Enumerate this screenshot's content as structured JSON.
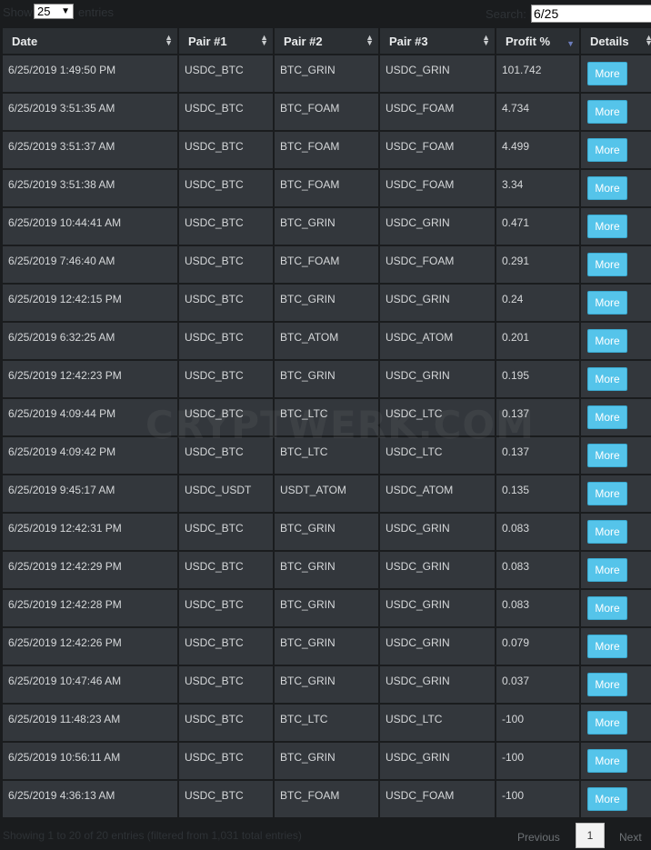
{
  "controls": {
    "show_prefix": "Show",
    "length_value": "25",
    "show_suffix": "entries",
    "search_label": "Search:",
    "search_value": "6/25"
  },
  "table": {
    "columns": [
      "Date",
      "Pair #1",
      "Pair #2",
      "Pair #3",
      "Profit %",
      "Details"
    ],
    "rows": [
      {
        "date": "6/25/2019 1:49:50 PM",
        "pair1": "USDC_BTC",
        "pair2": "BTC_GRIN",
        "pair3": "USDC_GRIN",
        "profit": "101.742",
        "details": "More"
      },
      {
        "date": "6/25/2019 3:51:35 AM",
        "pair1": "USDC_BTC",
        "pair2": "BTC_FOAM",
        "pair3": "USDC_FOAM",
        "profit": "4.734",
        "details": "More"
      },
      {
        "date": "6/25/2019 3:51:37 AM",
        "pair1": "USDC_BTC",
        "pair2": "BTC_FOAM",
        "pair3": "USDC_FOAM",
        "profit": "4.499",
        "details": "More"
      },
      {
        "date": "6/25/2019 3:51:38 AM",
        "pair1": "USDC_BTC",
        "pair2": "BTC_FOAM",
        "pair3": "USDC_FOAM",
        "profit": "3.34",
        "details": "More"
      },
      {
        "date": "6/25/2019 10:44:41 AM",
        "pair1": "USDC_BTC",
        "pair2": "BTC_GRIN",
        "pair3": "USDC_GRIN",
        "profit": "0.471",
        "details": "More"
      },
      {
        "date": "6/25/2019 7:46:40 AM",
        "pair1": "USDC_BTC",
        "pair2": "BTC_FOAM",
        "pair3": "USDC_FOAM",
        "profit": "0.291",
        "details": "More"
      },
      {
        "date": "6/25/2019 12:42:15 PM",
        "pair1": "USDC_BTC",
        "pair2": "BTC_GRIN",
        "pair3": "USDC_GRIN",
        "profit": "0.24",
        "details": "More"
      },
      {
        "date": "6/25/2019 6:32:25 AM",
        "pair1": "USDC_BTC",
        "pair2": "BTC_ATOM",
        "pair3": "USDC_ATOM",
        "profit": "0.201",
        "details": "More"
      },
      {
        "date": "6/25/2019 12:42:23 PM",
        "pair1": "USDC_BTC",
        "pair2": "BTC_GRIN",
        "pair3": "USDC_GRIN",
        "profit": "0.195",
        "details": "More"
      },
      {
        "date": "6/25/2019 4:09:44 PM",
        "pair1": "USDC_BTC",
        "pair2": "BTC_LTC",
        "pair3": "USDC_LTC",
        "profit": "0.137",
        "details": "More"
      },
      {
        "date": "6/25/2019 4:09:42 PM",
        "pair1": "USDC_BTC",
        "pair2": "BTC_LTC",
        "pair3": "USDC_LTC",
        "profit": "0.137",
        "details": "More"
      },
      {
        "date": "6/25/2019 9:45:17 AM",
        "pair1": "USDC_USDT",
        "pair2": "USDT_ATOM",
        "pair3": "USDC_ATOM",
        "profit": "0.135",
        "details": "More"
      },
      {
        "date": "6/25/2019 12:42:31 PM",
        "pair1": "USDC_BTC",
        "pair2": "BTC_GRIN",
        "pair3": "USDC_GRIN",
        "profit": "0.083",
        "details": "More"
      },
      {
        "date": "6/25/2019 12:42:29 PM",
        "pair1": "USDC_BTC",
        "pair2": "BTC_GRIN",
        "pair3": "USDC_GRIN",
        "profit": "0.083",
        "details": "More"
      },
      {
        "date": "6/25/2019 12:42:28 PM",
        "pair1": "USDC_BTC",
        "pair2": "BTC_GRIN",
        "pair3": "USDC_GRIN",
        "profit": "0.083",
        "details": "More"
      },
      {
        "date": "6/25/2019 12:42:26 PM",
        "pair1": "USDC_BTC",
        "pair2": "BTC_GRIN",
        "pair3": "USDC_GRIN",
        "profit": "0.079",
        "details": "More"
      },
      {
        "date": "6/25/2019 10:47:46 AM",
        "pair1": "USDC_BTC",
        "pair2": "BTC_GRIN",
        "pair3": "USDC_GRIN",
        "profit": "0.037",
        "details": "More"
      },
      {
        "date": "6/25/2019 11:48:23 AM",
        "pair1": "USDC_BTC",
        "pair2": "BTC_LTC",
        "pair3": "USDC_LTC",
        "profit": "-100",
        "details": "More"
      },
      {
        "date": "6/25/2019 10:56:11 AM",
        "pair1": "USDC_BTC",
        "pair2": "BTC_GRIN",
        "pair3": "USDC_GRIN",
        "profit": "-100",
        "details": "More"
      },
      {
        "date": "6/25/2019 4:36:13 AM",
        "pair1": "USDC_BTC",
        "pair2": "BTC_FOAM",
        "pair3": "USDC_FOAM",
        "profit": "-100",
        "details": "More"
      }
    ]
  },
  "watermark": "CRYPTWERK.COM",
  "footer": {
    "info": "Showing 1 to 20 of 20 entries (filtered from 1,031 total entries)",
    "previous": "Previous",
    "current_page": "1",
    "next": "Next"
  },
  "colors": {
    "accent_button": "#55c4ea",
    "header_bg": "#2b2f33",
    "cell_bg": "#33373c",
    "page_bg": "#1a1c1e"
  }
}
